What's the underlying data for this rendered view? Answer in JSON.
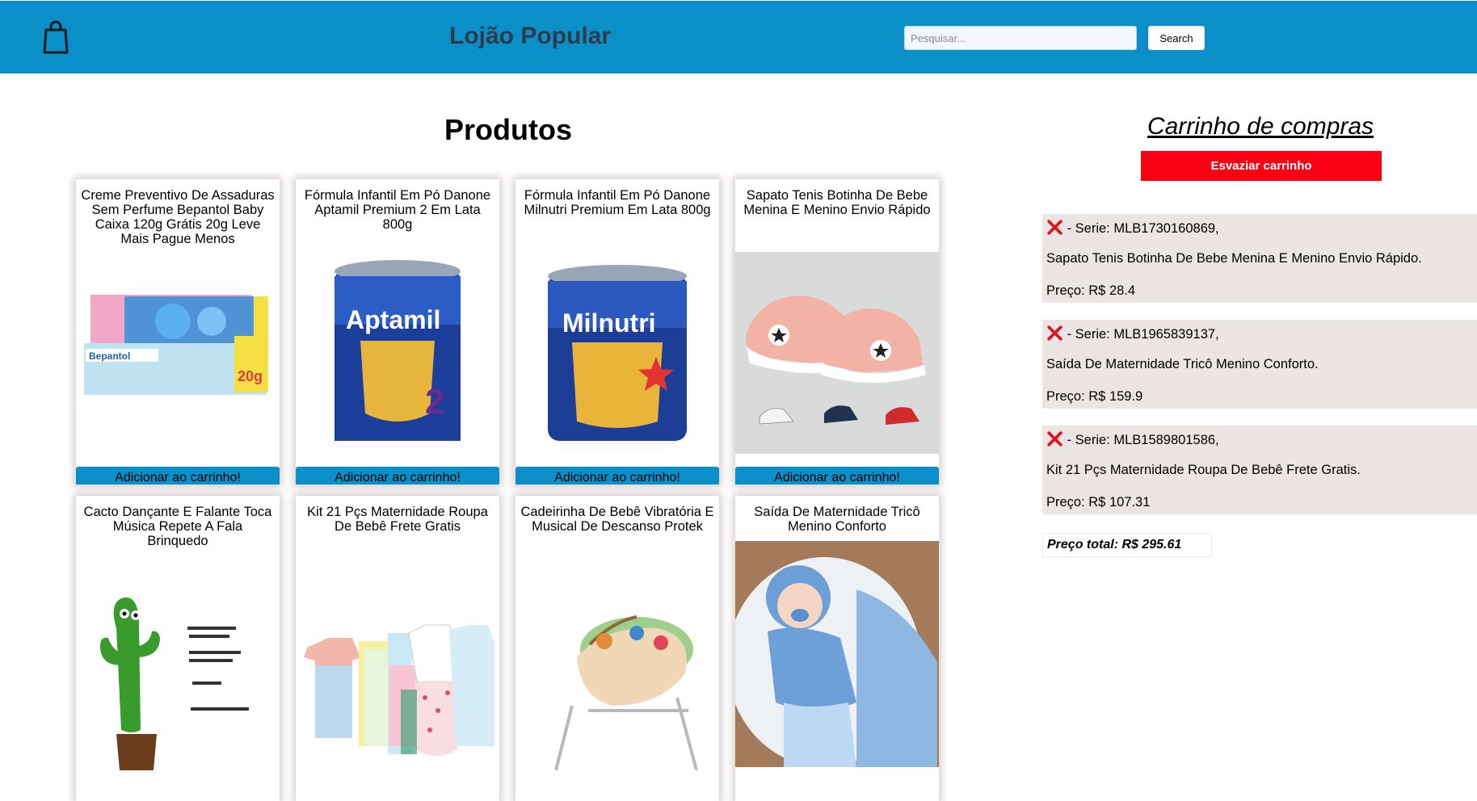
{
  "header": {
    "brand": "Lojão Popular",
    "search_placeholder": "Pesquisar...",
    "search_value": "",
    "search_button": "Search",
    "bag_icon": "shopping-bag-icon",
    "colors": {
      "header_bg": "#0b8fc9",
      "accent": "#0b8fc9",
      "danger": "#fb0012"
    }
  },
  "products": {
    "title": "Produtos",
    "add_label": "Adicionar ao carrinho!",
    "items": [
      {
        "title": "Creme Preventivo De Assaduras Sem Perfume Bepantol Baby Caixa 120g Grátis 20g Leve Mais Pague Menos",
        "image": "bepantol-cream-box-image"
      },
      {
        "title": "Fórmula Infantil Em Pó Danone Aptamil Premium 2 Em Lata 800g",
        "image": "aptamil-can-image"
      },
      {
        "title": "Fórmula Infantil Em Pó Danone Milnutri Premium Em Lata 800g",
        "image": "milnutri-can-image"
      },
      {
        "title": "Sapato Tenis Botinha De Bebe Menina E Menino Envio Rápido",
        "image": "baby-sneakers-image"
      },
      {
        "title": "Cacto Dançante E Falante Toca Música Repete A Fala Brinquedo",
        "image": "dancing-cactus-toy-image"
      },
      {
        "title": "Kit 21 Pçs Maternidade Roupa De Bebê Frete Gratis",
        "image": "baby-clothes-kit-image"
      },
      {
        "title": "Cadeirinha De Bebê Vibratória E Musical De Descanso Protek",
        "image": "baby-bouncer-image"
      },
      {
        "title": "Saída De Maternidade Tricô Menino Conforto",
        "image": "knit-baby-outfit-image"
      }
    ]
  },
  "cart": {
    "title": "Carrinho de compras",
    "empty_label": "Esvaziar carrinho",
    "items": [
      {
        "serie": " - Serie: MLB1730160869,",
        "name": "Sapato Tenis Botinha De Bebe Menina E Menino Envio Rápido.",
        "price": "Preço: R$ 28.4"
      },
      {
        "serie": " - Serie: MLB1965839137,",
        "name": "Saída De Maternidade Tricô Menino Conforto.",
        "price": "Preço: R$ 159.9"
      },
      {
        "serie": " - Serie: MLB1589801586,",
        "name": "Kit 21 Pçs Maternidade Roupa De Bebê Frete Gratis.",
        "price": "Preço: R$ 107.31"
      }
    ],
    "total": "Preço total: R$ 295.61",
    "remove_icon": "red-x-remove-icon"
  }
}
